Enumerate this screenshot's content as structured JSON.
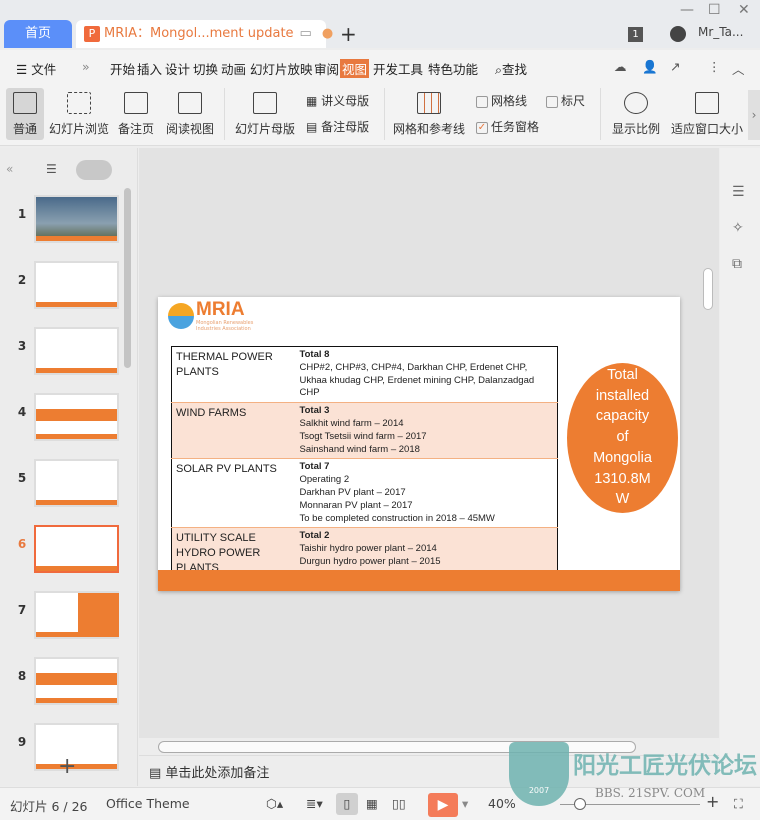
{
  "tabs": {
    "home": "首页",
    "document": "MRIA：Mongol...ment update",
    "new_tab": "+"
  },
  "user": {
    "badge": "1",
    "name": "Mr_Ta..."
  },
  "menu": {
    "file": "文件",
    "items": [
      "开始",
      "插入",
      "设计",
      "切换",
      "动画",
      "幻灯片放映",
      "审阅",
      "视图",
      "开发工具",
      "特色功能"
    ],
    "active": "视图",
    "search": "查找"
  },
  "ribbon": {
    "normal": "普通",
    "sorter": "幻灯片浏览",
    "notes_page": "备注页",
    "reading": "阅读视图",
    "slide_master": "幻灯片母版",
    "handout_master": "讲义母版",
    "notes_master": "备注母版",
    "grid_guides": "网格和参考线",
    "gridlines": "网格线",
    "ruler": "标尺",
    "task_pane": "任务窗格",
    "zoom": "显示比例",
    "fit_window": "适应窗口大小",
    "gridlines_checked": false,
    "ruler_checked": false,
    "task_pane_checked": true
  },
  "thumbnails": [
    {
      "n": "1"
    },
    {
      "n": "2"
    },
    {
      "n": "3"
    },
    {
      "n": "4"
    },
    {
      "n": "5"
    },
    {
      "n": "6",
      "selected": true
    },
    {
      "n": "7"
    },
    {
      "n": "8"
    },
    {
      "n": "9"
    }
  ],
  "slide": {
    "logo": {
      "title": "MRIA",
      "subtitle": "Mongolian Renewables Industries Association"
    },
    "rows": [
      {
        "category": "THERMAL POWER PLANTS",
        "total": "Total 8",
        "lines": [
          "CHP#2, CHP#3, CHP#4, Darkhan CHP, Erdenet CHP, Ukhaa khudag CHP, Erdenet mining CHP, Dalanzadgad CHP"
        ]
      },
      {
        "category": "WIND FARMS",
        "total": "Total 3",
        "lines": [
          "Salkhit wind farm – 2014",
          "Tsogt Tsetsii wind farm – 2017",
          "Sainshand wind farm – 2018"
        ]
      },
      {
        "category": "SOLAR PV PLANTS",
        "total": "Total 7",
        "lines": [
          "Operating 2",
          "Darkhan PV plant – 2017",
          "Monnaran PV plant – 2017",
          "To be completed construction in 2018 – 45MW"
        ]
      },
      {
        "category": "UTILITY SCALE HYDRO POWER PLANTS",
        "total": "Total 2",
        "lines": [
          "Taishir hydro power plant – 2014",
          "Durgun hydro power plant – 2015"
        ]
      }
    ],
    "callout": [
      "Total",
      "installed",
      "capacity",
      "of",
      "Mongolia",
      "1310.8M",
      "W"
    ],
    "accent": "#ed7d31"
  },
  "notes_placeholder": "单击此处添加备注",
  "status": {
    "slide_counter": "幻灯片 6 / 26",
    "theme": "Office Theme",
    "zoom": "40%"
  },
  "watermark": {
    "text": "阳光工匠光伏论坛",
    "url": "BBS. 21SPV. COM",
    "year": "2007"
  }
}
